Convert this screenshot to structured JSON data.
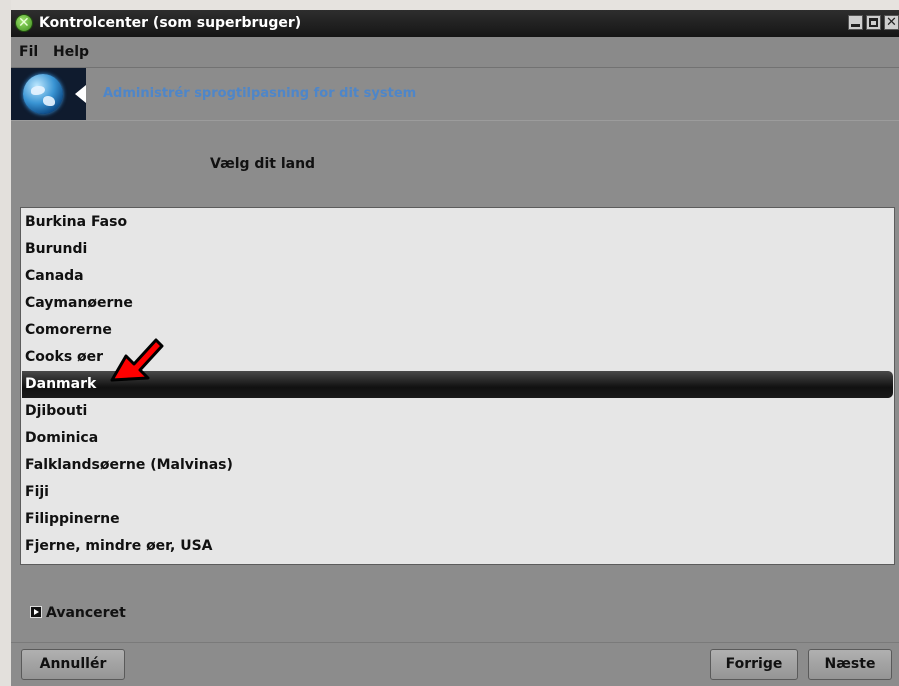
{
  "window": {
    "title": "Kontrolcenter (som superbruger)"
  },
  "menubar": {
    "items": [
      "Fil",
      "Help"
    ]
  },
  "banner": {
    "text": "Administrér sprogtilpasning for dit system"
  },
  "heading": "Vælg dit land",
  "country_list": {
    "items": [
      "Burkina Faso",
      "Burundi",
      "Canada",
      "Caymanøerne",
      "Comorerne",
      "Cooks øer",
      "Danmark",
      "Djibouti",
      "Dominica",
      "Falklandsøerne (Malvinas)",
      "Fiji",
      "Filippinerne",
      "Fjerne, mindre øer, USA"
    ],
    "selected": "Danmark"
  },
  "advanced": {
    "label": "Avanceret"
  },
  "buttons": {
    "cancel": "Annullér",
    "previous": "Forrige",
    "next": "Næste"
  },
  "colors": {
    "annotation_arrow": "#ff0000",
    "banner_text": "#4e86c9",
    "selection": "#111111"
  }
}
